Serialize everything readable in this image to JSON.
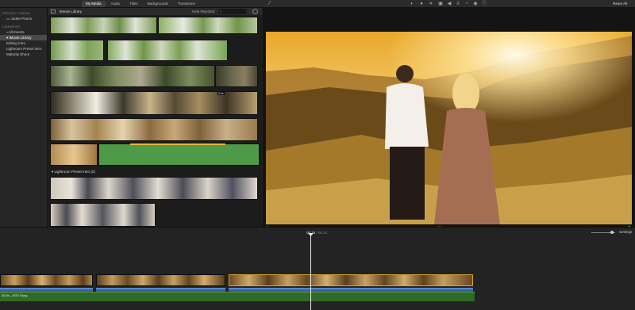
{
  "toolbar": {
    "tabs": [
      "My Media",
      "Audio",
      "Titles",
      "Backgrounds",
      "Transitions"
    ],
    "active_tab": "My Media",
    "reset_all": "Reset All"
  },
  "sidebar": {
    "project_media_header": "PROJECT MEDIA",
    "project_item": "Jodee Promo",
    "libraries_header": "LIBRARIES",
    "items": [
      {
        "label": "All Events"
      },
      {
        "label": "iMovie Library"
      },
      {
        "label": "Editing Intro"
      },
      {
        "label": "Lightroom Preset Intro"
      },
      {
        "label": "Maturity Shoot"
      }
    ]
  },
  "browser": {
    "title": "iMovie Library",
    "filter": "Hide Rejected",
    "search_placeholder": "",
    "event_group": {
      "name": "Lightroom Preset Intro",
      "count": "(2)"
    },
    "badge": "0.6s"
  },
  "timeline": {
    "current_time": "00:18",
    "duration": "00:21",
    "settings_label": "Settings",
    "music_track": "20.0s – BTS Song"
  },
  "colors": {
    "accent_selection": "#d8b14a",
    "audio_green": "#4f9a48",
    "video_blue": "#3a5fa0"
  }
}
